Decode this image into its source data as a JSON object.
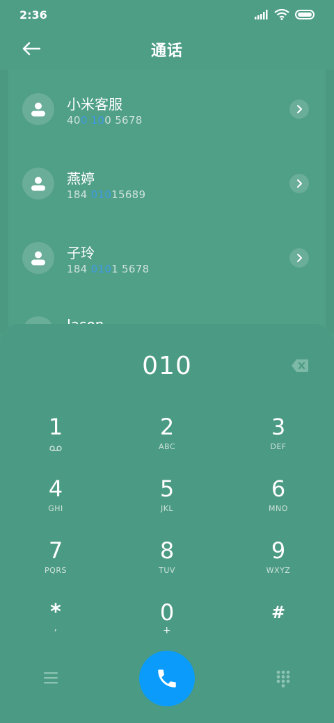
{
  "status_bar": {
    "time": "2:36"
  },
  "header": {
    "title": "通话"
  },
  "contacts": [
    {
      "name": "小米客服",
      "number_parts": [
        "40",
        "0 10",
        "0 5678"
      ]
    },
    {
      "name": "燕婷",
      "number_parts": [
        "184 ",
        "010",
        "15689"
      ]
    },
    {
      "name": "子玲",
      "number_parts": [
        "184 ",
        "010",
        "1 5678"
      ]
    },
    {
      "name": "Jason",
      "number_parts": [
        "",
        "",
        ""
      ]
    }
  ],
  "dialpad": {
    "input": "010",
    "keys": [
      {
        "digit": "1",
        "letters": ""
      },
      {
        "digit": "2",
        "letters": "ABC"
      },
      {
        "digit": "3",
        "letters": "DEF"
      },
      {
        "digit": "4",
        "letters": "GHI"
      },
      {
        "digit": "5",
        "letters": "JKL"
      },
      {
        "digit": "6",
        "letters": "MNO"
      },
      {
        "digit": "7",
        "letters": "PQRS"
      },
      {
        "digit": "8",
        "letters": "TUV"
      },
      {
        "digit": "9",
        "letters": "WXYZ"
      },
      {
        "digit": "*",
        "letters": ","
      },
      {
        "digit": "0",
        "letters": "+"
      },
      {
        "digit": "#",
        "letters": ""
      }
    ]
  },
  "colors": {
    "background": "#4e9e86",
    "highlight": "#3d9be9",
    "call_button": "#0a9bfb"
  },
  "icons": {
    "back": "arrow-left-icon",
    "voicemail": "voicemail-icon",
    "backspace": "backspace-icon",
    "call": "phone-icon",
    "menu": "menu-icon",
    "dialpad_toggle": "dialpad-grid-icon"
  }
}
